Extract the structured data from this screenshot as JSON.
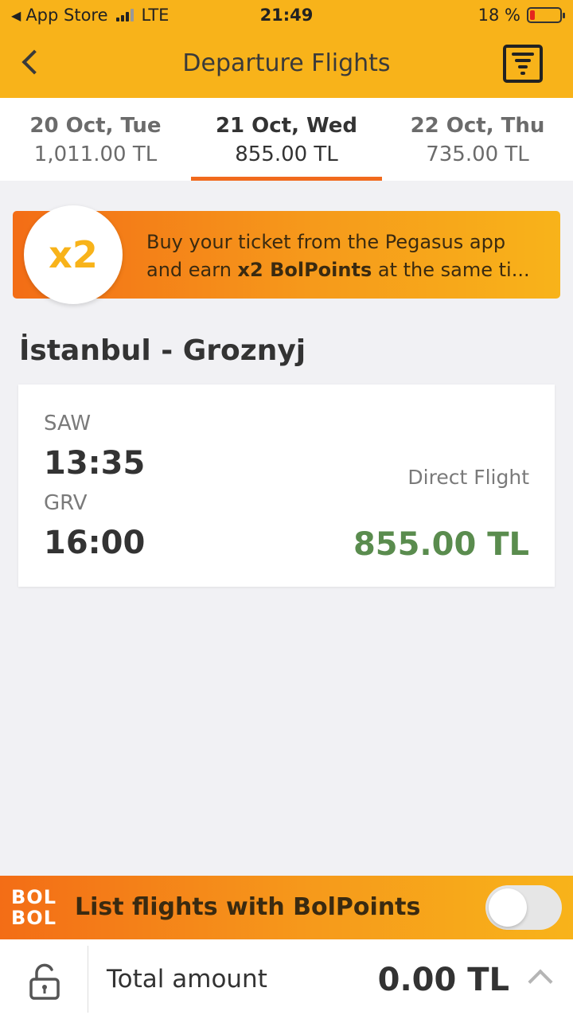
{
  "status_bar": {
    "carrier": "App Store",
    "network": "LTE",
    "time": "21:49",
    "battery": "18 %",
    "battery_level": 0.18
  },
  "header": {
    "title": "Departure Flights",
    "back_icon": "chevron-left-icon",
    "filter_icon": "filter-icon"
  },
  "date_tabs": [
    {
      "date": "20 Oct, Tue",
      "price": "1,011.00 TL",
      "active": false
    },
    {
      "date": "21 Oct, Wed",
      "price": "855.00 TL",
      "active": true
    },
    {
      "date": "22 Oct, Thu",
      "price": "735.00 TL",
      "active": false
    }
  ],
  "promo": {
    "badge": "x2",
    "line1": "Buy your ticket from the Pegasus app",
    "line2_prefix": "and earn ",
    "line2_bold": "x2 BolPoints",
    "line2_suffix": " at the same ti..."
  },
  "route": "İstanbul - Groznyj",
  "flight": {
    "departure_code": "SAW",
    "departure_time": "13:35",
    "arrival_code": "GRV",
    "arrival_time": "16:00",
    "type": "Direct Flight",
    "price": "855.00 TL"
  },
  "bolpoints": {
    "logo_line1": "BOL",
    "logo_line2": "BOL",
    "label": "List flights with BolPoints",
    "toggle_on": false
  },
  "total": {
    "label": "Total amount",
    "value": "0.00 TL"
  },
  "colors": {
    "brand_yellow": "#f8b31a",
    "brand_orange": "#f36d16",
    "price_green": "#5a8c4e"
  }
}
